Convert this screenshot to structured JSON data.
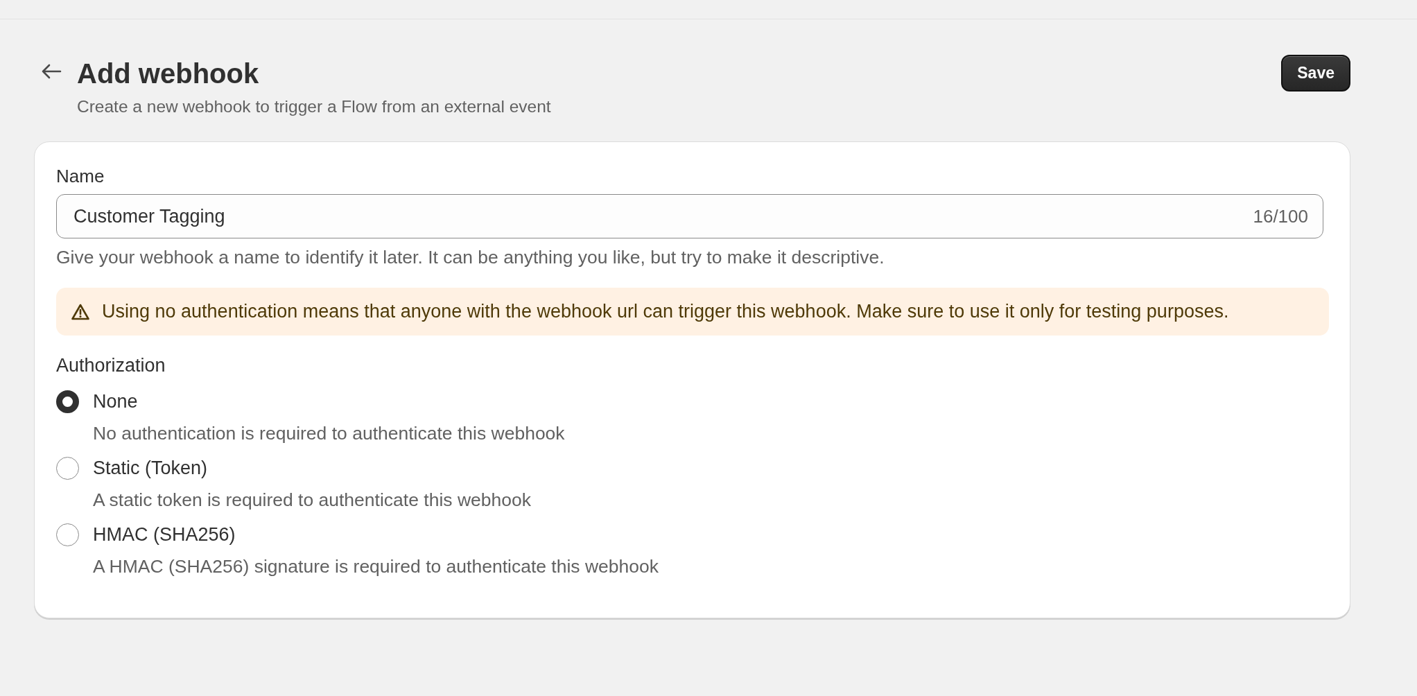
{
  "header": {
    "title": "Add webhook",
    "subtitle": "Create a new webhook to trigger a Flow from an external event",
    "save_button": "Save"
  },
  "name_field": {
    "label": "Name",
    "value": "Customer Tagging",
    "counter": "16/100",
    "help": "Give your webhook a name to identify it later. It can be anything you like, but try to make it descriptive."
  },
  "warning_banner": {
    "text": "Using no authentication means that anyone with the webhook url can trigger this webhook. Make sure to use it only for testing purposes."
  },
  "authorization": {
    "label": "Authorization",
    "options": [
      {
        "label": "None",
        "description": "No authentication is required to authenticate this webhook",
        "selected": true
      },
      {
        "label": "Static (Token)",
        "description": "A static token is required to authenticate this webhook",
        "selected": false
      },
      {
        "label": "HMAC (SHA256)",
        "description": "A HMAC (SHA256) signature is required to authenticate this webhook",
        "selected": false
      }
    ]
  }
}
